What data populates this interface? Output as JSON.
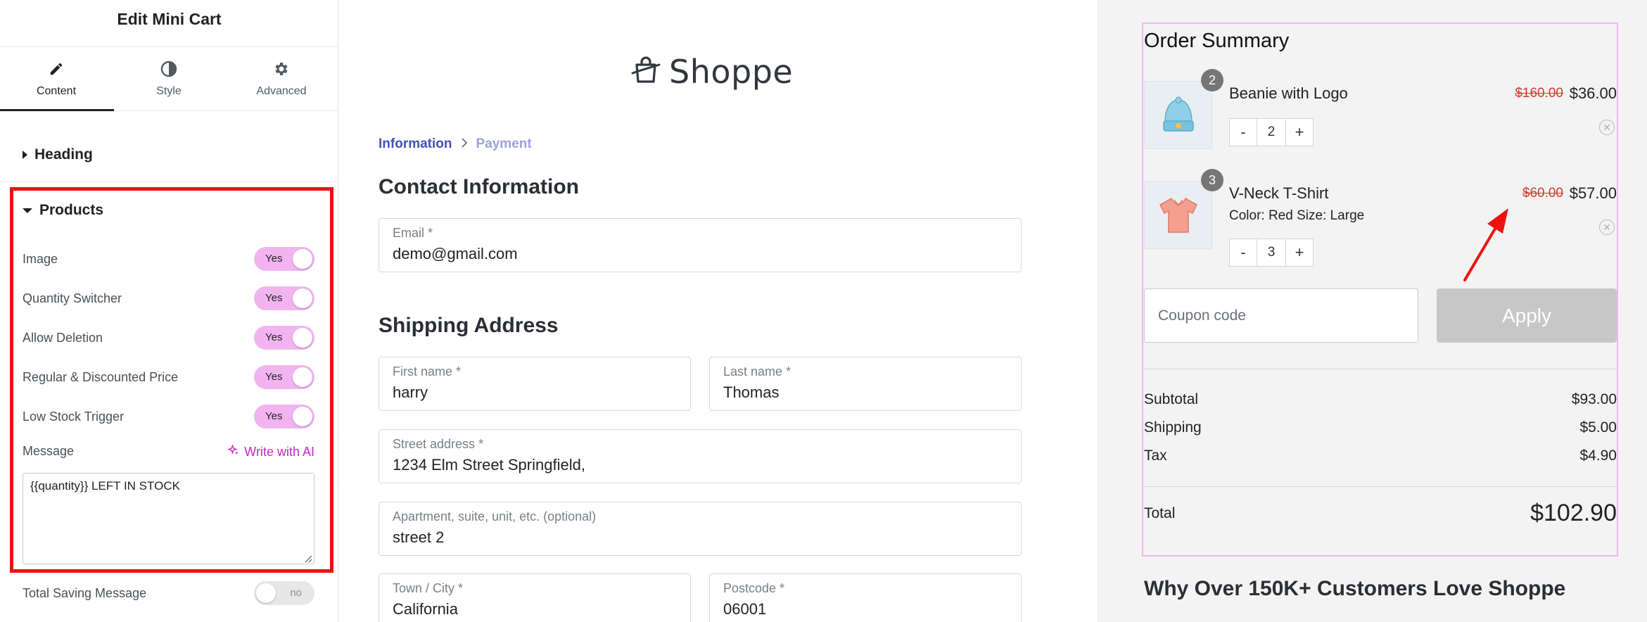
{
  "editor": {
    "title": "Edit Mini Cart",
    "tabs": [
      {
        "label": "Content",
        "icon": "pencil-icon"
      },
      {
        "label": "Style",
        "icon": "contrast-icon"
      },
      {
        "label": "Advanced",
        "icon": "gear-icon"
      }
    ],
    "sections": {
      "heading": "Heading",
      "products": "Products"
    },
    "controls": [
      {
        "label": "Image",
        "value": "Yes"
      },
      {
        "label": "Quantity Switcher",
        "value": "Yes"
      },
      {
        "label": "Allow Deletion",
        "value": "Yes"
      },
      {
        "label": "Regular & Discounted Price",
        "value": "Yes"
      },
      {
        "label": "Low Stock Trigger",
        "value": "Yes"
      }
    ],
    "message": {
      "label": "Message",
      "ai_link": "Write with AI",
      "value": "{{quantity}} LEFT IN STOCK"
    },
    "total_saving": {
      "label": "Total Saving Message",
      "value": "no"
    }
  },
  "checkout": {
    "logo_text": "Shoppe",
    "breadcrumb": {
      "current": "Information",
      "next": "Payment"
    },
    "contact_title": "Contact Information",
    "shipping_title": "Shipping Address",
    "fields": {
      "email": {
        "label": "Email *",
        "value": "demo@gmail.com"
      },
      "first_name": {
        "label": "First name *",
        "value": "harry"
      },
      "last_name": {
        "label": "Last name *",
        "value": "Thomas"
      },
      "street": {
        "label": "Street address *",
        "value": "1234 Elm Street Springfield,"
      },
      "apartment": {
        "label": "Apartment, suite, unit, etc. (optional)",
        "value": "street 2"
      },
      "city": {
        "label": "Town / City *",
        "value": "California"
      },
      "postcode": {
        "label": "Postcode *",
        "value": "06001"
      }
    }
  },
  "summary": {
    "title": "Order Summary",
    "items": [
      {
        "name": "Beanie with Logo",
        "meta": "",
        "badge": "2",
        "qty": "2",
        "old_price": "$160.00",
        "new_price": "$36.00"
      },
      {
        "name": "V-Neck T-Shirt",
        "meta": "Color:  Red Size:  Large",
        "badge": "3",
        "qty": "3",
        "old_price": "$60.00",
        "new_price": "$57.00"
      }
    ],
    "qty_minus": "-",
    "qty_plus": "+",
    "coupon_placeholder": "Coupon code",
    "apply_label": "Apply",
    "subtotal": {
      "label": "Subtotal",
      "value": "$93.00"
    },
    "shipping": {
      "label": "Shipping",
      "value": "$5.00"
    },
    "tax": {
      "label": "Tax",
      "value": "$4.90"
    },
    "total": {
      "label": "Total",
      "value": "$102.90"
    },
    "accent_border": "#f0b6ef"
  },
  "promo_heading": "Why Over 150K+ Customers Love Shoppe",
  "colors": {
    "toggle_on": "#f1b4f0",
    "highlight_box": "#ee1111",
    "ai_link": "#c526c6",
    "breadcrumb_active": "#4054b2",
    "old_price": "#d33a2a",
    "annotation_arrow": "#ee1111"
  }
}
